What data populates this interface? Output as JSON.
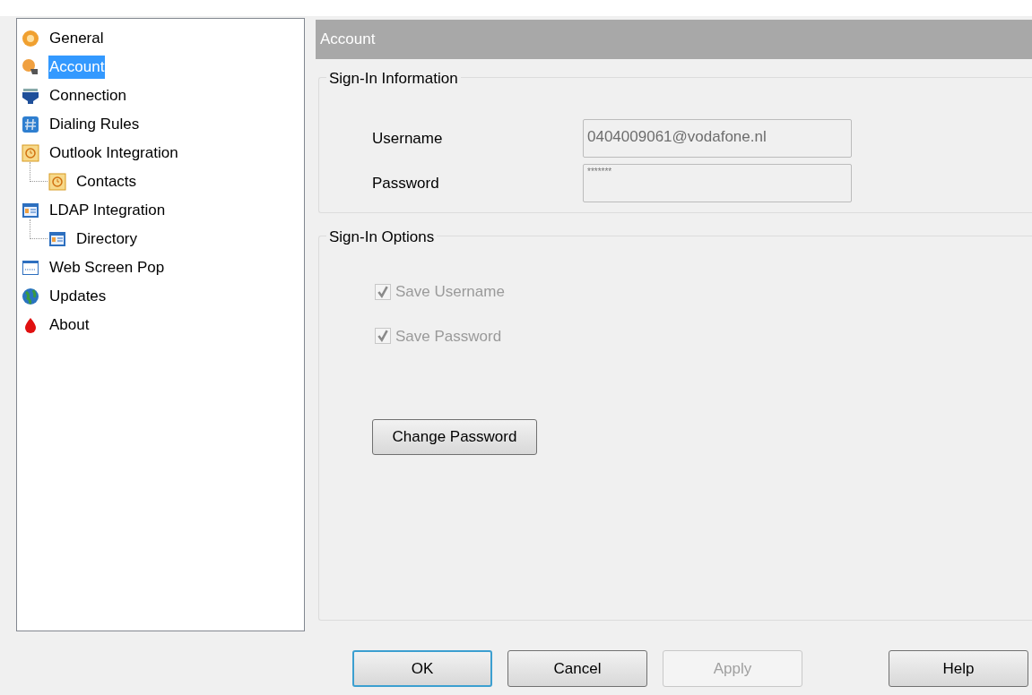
{
  "sidebar": {
    "items": [
      {
        "label": "General",
        "selected": false
      },
      {
        "label": "Account",
        "selected": true
      },
      {
        "label": "Connection",
        "selected": false
      },
      {
        "label": "Dialing Rules",
        "selected": false
      },
      {
        "label": "Outlook Integration",
        "selected": false,
        "children": [
          {
            "label": "Contacts",
            "selected": false
          }
        ]
      },
      {
        "label": "LDAP Integration",
        "selected": false,
        "children": [
          {
            "label": "Directory",
            "selected": false
          }
        ]
      },
      {
        "label": "Web Screen Pop",
        "selected": false
      },
      {
        "label": "Updates",
        "selected": false
      },
      {
        "label": "About",
        "selected": false
      }
    ]
  },
  "header": {
    "title": "Account"
  },
  "sign_in_information": {
    "title": "Sign-In Information",
    "fields": [
      {
        "label": "Username",
        "value": "0404009061@vodafone.nl",
        "kind": "text"
      },
      {
        "label": "Password",
        "value": "*******",
        "kind": "password"
      }
    ]
  },
  "sign_in_options": {
    "title": "Sign-In Options",
    "checkboxes": [
      {
        "label": "Save Username",
        "checked": true,
        "disabled": true
      },
      {
        "label": "Save Password",
        "checked": true,
        "disabled": true
      }
    ],
    "button": "Change Password"
  },
  "buttons": [
    {
      "label": "OK",
      "default": true,
      "disabled": false
    },
    {
      "label": "Cancel",
      "default": false,
      "disabled": false
    },
    {
      "label": "Apply",
      "default": false,
      "disabled": true
    },
    {
      "label": "Help",
      "default": false,
      "disabled": false
    }
  ]
}
